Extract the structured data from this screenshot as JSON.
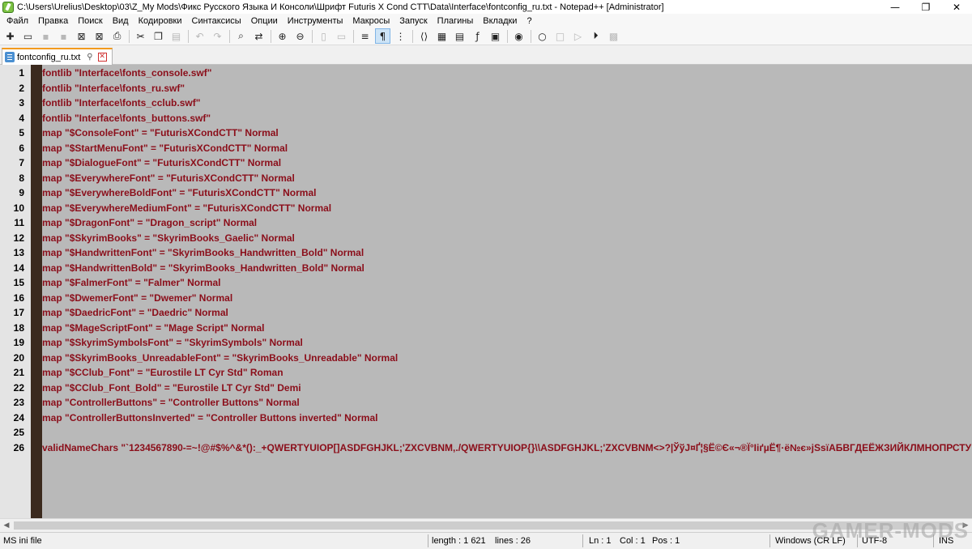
{
  "titlebar": {
    "title": "C:\\Users\\Urelius\\Desktop\\03\\Z_My Mods\\Фикс Русского Языка И Консоли\\Шрифт Futuris X Cond CTT\\Data\\Interface\\fontconfig_ru.txt - Notepad++ [Administrator]",
    "minimize": "—",
    "maximize": "❐",
    "close": "✕"
  },
  "menu": [
    "Файл",
    "Правка",
    "Поиск",
    "Вид",
    "Кодировки",
    "Синтаксисы",
    "Опции",
    "Инструменты",
    "Макросы",
    "Запуск",
    "Плагины",
    "Вкладки",
    "?"
  ],
  "toolbar": [
    {
      "name": "new-file-icon",
      "glyph": "✚",
      "dim": false
    },
    {
      "name": "open-file-icon",
      "glyph": "▭",
      "dim": false
    },
    {
      "name": "save-icon",
      "glyph": "▪",
      "dim": true
    },
    {
      "name": "save-all-icon",
      "glyph": "▪",
      "dim": true
    },
    {
      "name": "close-icon",
      "glyph": "⊠",
      "dim": false
    },
    {
      "name": "close-all-icon",
      "glyph": "⊠",
      "dim": false
    },
    {
      "name": "print-icon",
      "glyph": "⎙",
      "dim": false
    },
    {
      "sep": true
    },
    {
      "name": "cut-icon",
      "glyph": "✂",
      "dim": false
    },
    {
      "name": "copy-icon",
      "glyph": "❐",
      "dim": false
    },
    {
      "name": "paste-icon",
      "glyph": "▤",
      "dim": true
    },
    {
      "sep": true
    },
    {
      "name": "undo-icon",
      "glyph": "↶",
      "dim": true
    },
    {
      "name": "redo-icon",
      "glyph": "↷",
      "dim": true
    },
    {
      "sep": true
    },
    {
      "name": "find-icon",
      "glyph": "⌕",
      "dim": false
    },
    {
      "name": "replace-icon",
      "glyph": "⇄",
      "dim": false
    },
    {
      "sep": true
    },
    {
      "name": "zoom-in-icon",
      "glyph": "⊕",
      "dim": false
    },
    {
      "name": "zoom-out-icon",
      "glyph": "⊖",
      "dim": false
    },
    {
      "sep": true
    },
    {
      "name": "sync-vertical-icon",
      "glyph": "▯",
      "dim": true
    },
    {
      "name": "sync-horizontal-icon",
      "glyph": "▭",
      "dim": true
    },
    {
      "sep": true
    },
    {
      "name": "word-wrap-icon",
      "glyph": "≡",
      "dim": false
    },
    {
      "name": "show-all-chars-icon",
      "glyph": "¶",
      "dim": false,
      "active": true
    },
    {
      "name": "indent-guide-icon",
      "glyph": "⋮",
      "dim": false
    },
    {
      "sep": true
    },
    {
      "name": "xml-tag-icon",
      "glyph": "⟨⟩",
      "dim": false
    },
    {
      "name": "document-map-icon",
      "glyph": "▦",
      "dim": false
    },
    {
      "name": "document-list-icon",
      "glyph": "▤",
      "dim": false
    },
    {
      "name": "function-list-icon",
      "glyph": "ƒ",
      "dim": false
    },
    {
      "name": "folder-workspace-icon",
      "glyph": "▣",
      "dim": false
    },
    {
      "sep": true
    },
    {
      "name": "monitoring-icon",
      "glyph": "◉",
      "dim": false
    },
    {
      "sep": true
    },
    {
      "name": "record-macro-icon",
      "glyph": "○",
      "dim": false
    },
    {
      "name": "stop-macro-icon",
      "glyph": "□",
      "dim": true
    },
    {
      "name": "play-macro-icon",
      "glyph": "▷",
      "dim": true
    },
    {
      "name": "run-macro-multiple-icon",
      "glyph": "⏵",
      "dim": false
    },
    {
      "name": "save-macro-icon",
      "glyph": "▩",
      "dim": true
    }
  ],
  "tab": {
    "label": "fontconfig_ru.txt",
    "pin": "⚲",
    "close": "✕"
  },
  "lines": [
    "fontlib \"Interface\\fonts_console.swf\"",
    "fontlib \"Interface\\fonts_ru.swf\"",
    "fontlib \"Interface\\fonts_cclub.swf\"",
    "fontlib \"Interface\\fonts_buttons.swf\"",
    "map \"$ConsoleFont\" = \"FuturisXCondCTT\" Normal",
    "map \"$StartMenuFont\" = \"FuturisXCondCTT\" Normal",
    "map \"$DialogueFont\" = \"FuturisXCondCTT\" Normal",
    "map \"$EverywhereFont\" = \"FuturisXCondCTT\" Normal",
    "map \"$EverywhereBoldFont\" = \"FuturisXCondCTT\" Normal",
    "map \"$EverywhereMediumFont\" = \"FuturisXCondCTT\" Normal",
    "map \"$DragonFont\" = \"Dragon_script\" Normal",
    "map \"$SkyrimBooks\" = \"SkyrimBooks_Gaelic\" Normal",
    "map \"$HandwrittenFont\" = \"SkyrimBooks_Handwritten_Bold\" Normal",
    "map \"$HandwrittenBold\" = \"SkyrimBooks_Handwritten_Bold\" Normal",
    "map \"$FalmerFont\" = \"Falmer\" Normal",
    "map \"$DwemerFont\" = \"Dwemer\" Normal",
    "map \"$DaedricFont\" = \"Daedric\" Normal",
    "map \"$MageScriptFont\" = \"Mage Script\" Normal",
    "map \"$SkyrimSymbolsFont\" = \"SkyrimSymbols\" Normal",
    "map \"$SkyrimBooks_UnreadableFont\" = \"SkyrimBooks_Unreadable\" Normal",
    "map \"$CClub_Font\" = \"Eurostile LT Cyr Std\" Roman",
    "map \"$CClub_Font_Bold\" = \"Eurostile LT Cyr Std\" Demi",
    "map \"ControllerButtons\" = \"Controller Buttons\" Normal",
    "map \"ControllerButtonsInverted\" = \"Controller Buttons inverted\" Normal",
    "",
    "validNameChars \"`1234567890-=~!@#$%^&*():_+QWERTYUIOP[]ASDFGHJKL;'ZXCVBNM,./QWERTYUIOP{}\\\\ASDFGHJKL;'ZXCVBNM<>?|ЎўЈ¤Ґ¦§Ё©Є«¬®Ї°ІіґµЁ¶·ё№є»јЅѕїАБВГДЕЁЖЗИЙКЛМНОПРСТУ"
  ],
  "line_numbers": [
    "1",
    "2",
    "3",
    "4",
    "5",
    "6",
    "7",
    "8",
    "9",
    "10",
    "11",
    "12",
    "13",
    "14",
    "15",
    "16",
    "17",
    "18",
    "19",
    "20",
    "21",
    "22",
    "23",
    "24",
    "25",
    "26"
  ],
  "scrollbar": {
    "left": "◀",
    "right": "▶"
  },
  "status": {
    "filetype": "MS ini file",
    "length": "length : 1 621",
    "lines": "lines : 26",
    "ln": "Ln : 1",
    "col": "Col : 1",
    "pos": "Pos : 1",
    "eol": "Windows (CR LF)",
    "encoding": "UTF-8",
    "mode": "INS"
  },
  "watermark": "GAMER-MODS"
}
